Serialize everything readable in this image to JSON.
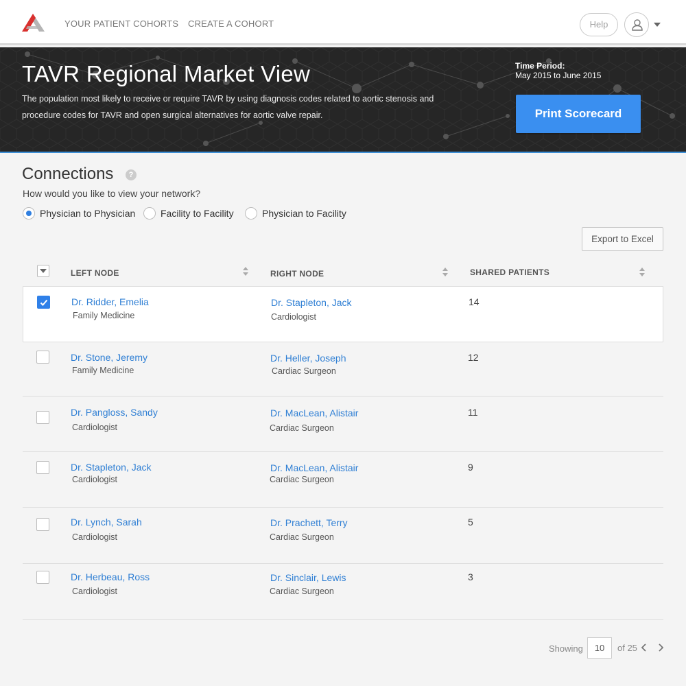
{
  "nav": {
    "links": [
      {
        "label": "YOUR PATIENT COHORTS"
      },
      {
        "label": "CREATE A COHORT"
      }
    ],
    "help_label": "Help",
    "icons": {
      "logo": "brand-logo",
      "user": "user-icon",
      "caret": "chevron-down-icon"
    }
  },
  "hero": {
    "title": "TAVR Regional Market View",
    "description": "The population most likely to receive or require TAVR by using diagnosis codes related to aortic stenosis and procedure codes for TAVR and open surgical alternatives for aortic valve repair.",
    "time_period_label": "Time Period:",
    "time_period_value": "May 2015 to June 2015",
    "print_button": "Print Scorecard"
  },
  "connections": {
    "title": "Connections",
    "help_glyph": "?",
    "question": "How would you like to view your network?",
    "view_options": [
      {
        "label": "Physician to Physician",
        "selected": true
      },
      {
        "label": "Facility to Facility",
        "selected": false
      },
      {
        "label": "Physician to Facility",
        "selected": false
      }
    ],
    "export_button": "Export to Excel"
  },
  "table": {
    "columns": [
      "LEFT NODE",
      "RIGHT NODE",
      "SHARED PATIENTS"
    ],
    "rows": [
      {
        "checked": true,
        "left_name": "Dr. Ridder, Emelia",
        "left_role": "Family Medicine",
        "right_name": "Dr. Stapleton, Jack",
        "right_role": "Cardiologist",
        "shared": "14"
      },
      {
        "checked": false,
        "left_name": "Dr. Stone, Jeremy",
        "left_role": "Family Medicine",
        "right_name": "Dr. Heller, Joseph",
        "right_role": "Cardiac Surgeon",
        "shared": "12"
      },
      {
        "checked": false,
        "left_name": "Dr. Pangloss, Sandy",
        "left_role": "Cardiologist",
        "right_name": "Dr. MacLean, Alistair",
        "right_role": "Cardiac Surgeon",
        "shared": "11"
      },
      {
        "checked": false,
        "left_name": "Dr. Stapleton, Jack",
        "left_role": "Cardiologist",
        "right_name": "Dr. MacLean, Alistair",
        "right_role": "Cardiac Surgeon",
        "shared": "9"
      },
      {
        "checked": false,
        "left_name": "Dr. Lynch, Sarah",
        "left_role": "Cardiologist",
        "right_name": "Dr. Prachett, Terry",
        "right_role": "Cardiac Surgeon",
        "shared": "5"
      },
      {
        "checked": false,
        "left_name": "Dr. Herbeau, Ross",
        "left_role": "Cardiologist",
        "right_name": "Dr. Sinclair, Lewis",
        "right_role": "Cardiac Surgeon",
        "shared": "3"
      }
    ]
  },
  "pagination": {
    "showing_label": "Showing",
    "page_size": "10",
    "of_total": "of 25"
  },
  "colors": {
    "accent": "#3a8ff0",
    "link": "#2f7fd4",
    "hero_bg": "#262626",
    "logo_red": "#d9302e",
    "logo_grey": "#b5b5b5"
  }
}
